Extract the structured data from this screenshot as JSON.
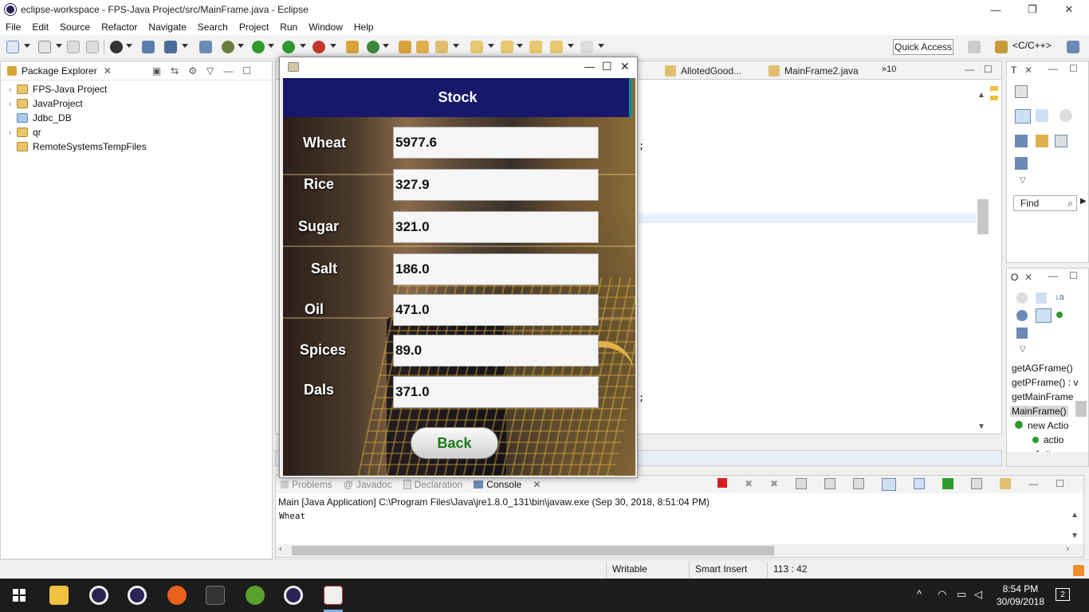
{
  "window": {
    "title": "eclipse-workspace - FPS-Java Project/src/MainFrame.java - Eclipse",
    "controls": {
      "minimize": "—",
      "maximize": "❐",
      "close": "✕"
    }
  },
  "menu": [
    "File",
    "Edit",
    "Source",
    "Refactor",
    "Navigate",
    "Search",
    "Project",
    "Run",
    "Window",
    "Help"
  ],
  "toolbar": {
    "quick_access": "Quick Access",
    "perspective": "<C/C++>"
  },
  "package_explorer": {
    "title": "Package Explorer",
    "items": [
      {
        "label": "FPS-Java Project",
        "expandable": true
      },
      {
        "label": "JavaProject",
        "expandable": true
      },
      {
        "label": "Jdbc_DB",
        "expandable": false
      },
      {
        "label": "qr",
        "expandable": true
      },
      {
        "label": "RemoteSystemsTempFiles",
        "expandable": false
      }
    ]
  },
  "editor": {
    "tabs": [
      "AllotedGood...",
      "MainFrame2.java"
    ],
    "overflow": "»10",
    "code_fragments": [
      ";",
      ";"
    ]
  },
  "right_panel_t": {
    "title": "T",
    "find_placeholder": "Find"
  },
  "outline": {
    "title": "O",
    "items": [
      "getAGFrame()",
      "getPFrame() : v",
      "getMainFrame",
      "MainFrame()",
      "new Actio",
      "actio",
      "new Actio"
    ]
  },
  "console": {
    "tabs": [
      "Problems",
      "Javadoc",
      "Declaration",
      "Console"
    ],
    "active_tab": "Console",
    "launch": "Main [Java Application] C:\\Program Files\\Java\\jre1.8.0_131\\bin\\javaw.exe (Sep 30, 2018, 8:51:04 PM)",
    "output": "Wheat"
  },
  "statusbar": {
    "writable": "Writable",
    "insert_mode": "Smart Insert",
    "position": "113 : 42"
  },
  "taskbar": {
    "time": "8:54 PM",
    "date": "30/09/2018",
    "notifications": "2"
  },
  "dialog": {
    "controls": {
      "minimize": "—",
      "maximize": "☐",
      "close": "✕"
    },
    "header": "Stock",
    "items": [
      {
        "label": "Wheat",
        "value": "5977.6"
      },
      {
        "label": "Rice",
        "value": "327.9"
      },
      {
        "label": "Sugar",
        "value": "321.0"
      },
      {
        "label": "Salt",
        "value": "186.0"
      },
      {
        "label": "Oil",
        "value": "471.0"
      },
      {
        "label": "Spices",
        "value": "89.0"
      },
      {
        "label": "Dals",
        "value": "371.0"
      }
    ],
    "back_button": "Back"
  }
}
